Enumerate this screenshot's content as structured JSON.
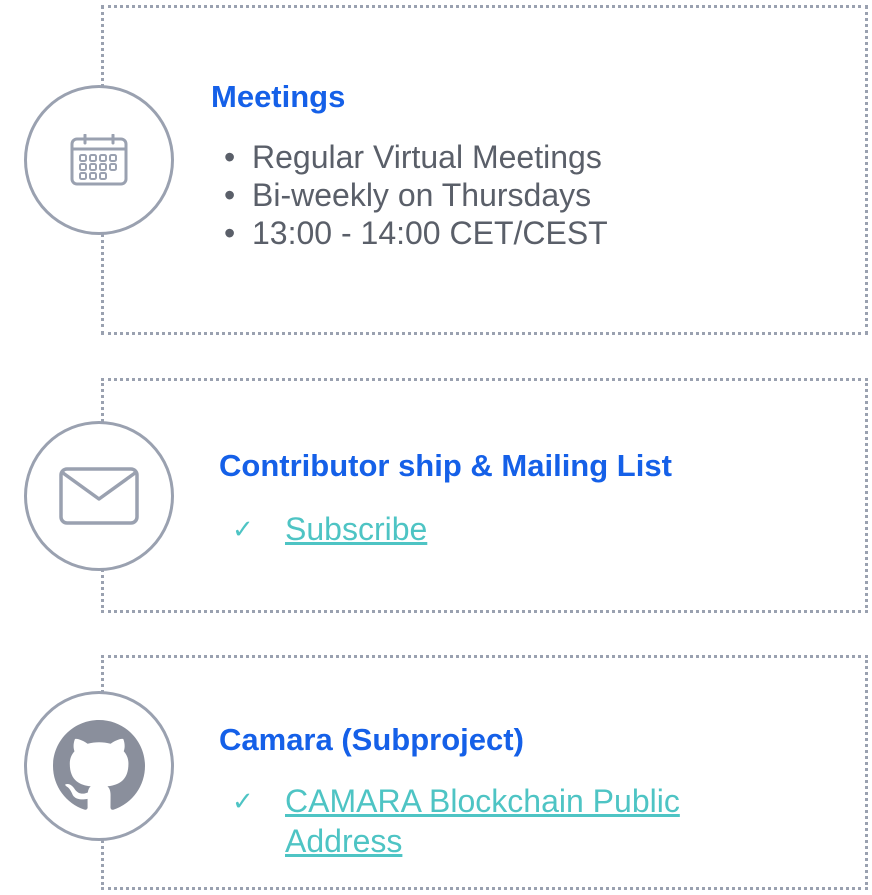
{
  "meetings": {
    "title": "Meetings",
    "items": [
      "Regular Virtual Meetings",
      "Bi-weekly on Thursdays",
      "13:00 - 14:00 CET/CEST"
    ],
    "icon": "calendar-icon"
  },
  "contributor": {
    "title": "Contributor ship & Mailing List",
    "check": "✓",
    "link": "Subscribe",
    "icon": "mail-icon"
  },
  "camara": {
    "title": "Camara  (Subproject)",
    "check": "✓",
    "link": "CAMARA Blockchain Public Address",
    "icon": "github-icon"
  },
  "colors": {
    "title": "#1560e8",
    "text": "#5a5f69",
    "link": "#4ec4c4",
    "border": "#9aa1b0"
  }
}
